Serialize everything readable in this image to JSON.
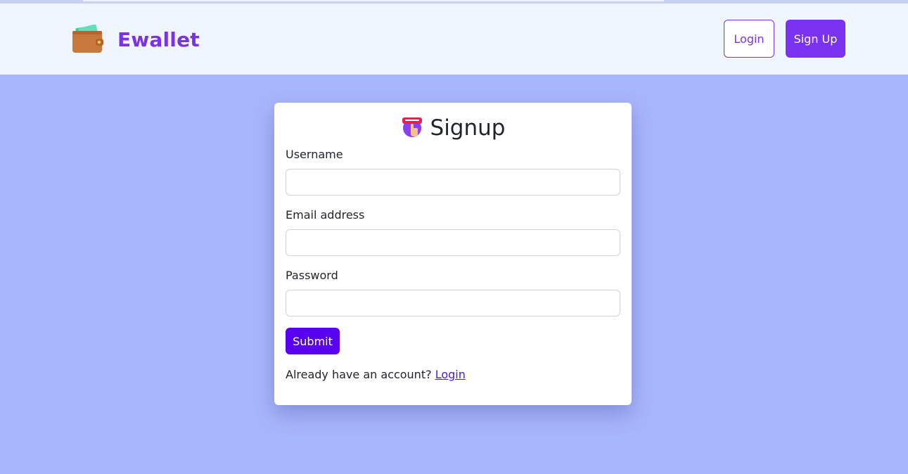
{
  "brand": {
    "name": "Ewallet",
    "logo_icon": "wallet-icon"
  },
  "nav": {
    "login_label": "Login",
    "signup_label": "Sign Up"
  },
  "form": {
    "title": "Signup",
    "title_icon": "signup-badge-icon",
    "fields": [
      {
        "label": "Username",
        "value": "",
        "placeholder": ""
      },
      {
        "label": "Email address",
        "value": "",
        "placeholder": ""
      },
      {
        "label": "Password",
        "value": "",
        "placeholder": ""
      }
    ],
    "submit_label": "Submit",
    "footer_text": "Already have an account?",
    "footer_link": "Login"
  },
  "colors": {
    "page_bg": "#a8b6fd",
    "navbar_bg": "#f0f6ff",
    "brand": "#7b32e6",
    "signup_button": "#7b32f0",
    "submit_button": "#5a00f0",
    "link": "#4a1ae6"
  }
}
